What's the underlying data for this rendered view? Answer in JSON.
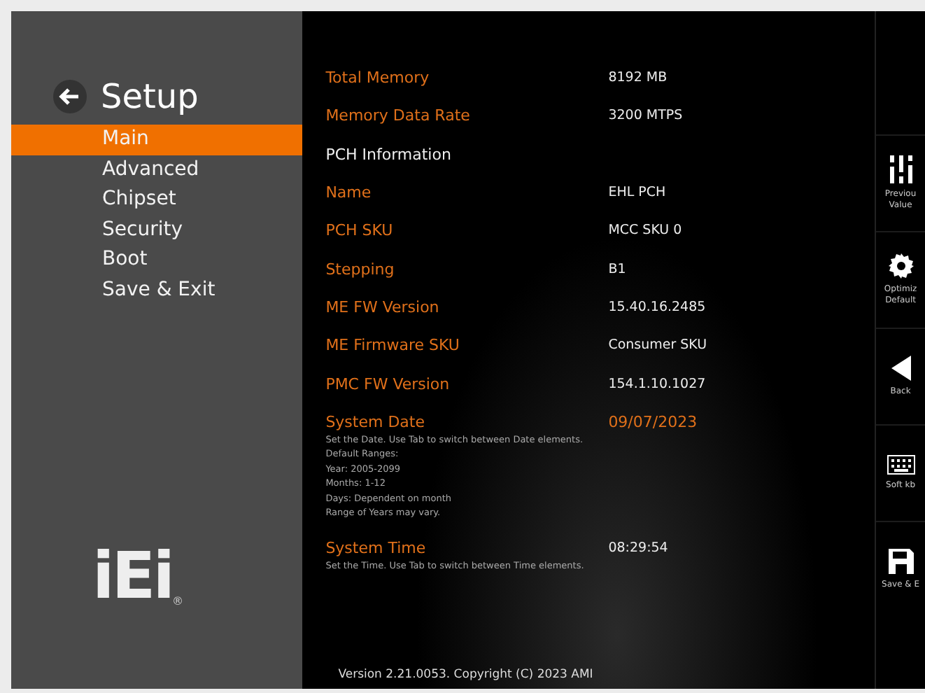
{
  "sidebar": {
    "title": "Setup",
    "items": [
      {
        "label": "Main",
        "selected": true
      },
      {
        "label": "Advanced",
        "selected": false
      },
      {
        "label": "Chipset",
        "selected": false
      },
      {
        "label": "Security",
        "selected": false
      },
      {
        "label": "Boot",
        "selected": false
      },
      {
        "label": "Save & Exit",
        "selected": false
      }
    ],
    "logo": "iEi",
    "logo_mark": "®"
  },
  "rows": [
    {
      "kind": "field",
      "label": "Total Memory",
      "value": "8192 MB",
      "selected": false
    },
    {
      "kind": "field",
      "label": "Memory Data Rate",
      "value": "3200 MTPS",
      "selected": false
    },
    {
      "kind": "heading",
      "label": "PCH Information"
    },
    {
      "kind": "field",
      "label": "Name",
      "value": "EHL PCH",
      "selected": false
    },
    {
      "kind": "field",
      "label": "PCH SKU",
      "value": "MCC SKU 0",
      "selected": false
    },
    {
      "kind": "field",
      "label": "Stepping",
      "value": "B1",
      "selected": false
    },
    {
      "kind": "field",
      "label": "ME FW Version",
      "value": "15.40.16.2485",
      "selected": false
    },
    {
      "kind": "field",
      "label": "ME Firmware SKU",
      "value": "Consumer SKU",
      "selected": false
    },
    {
      "kind": "field",
      "label": "PMC FW Version",
      "value": "154.1.10.1027",
      "selected": false
    },
    {
      "kind": "field",
      "label": "System Date",
      "value": "09/07/2023",
      "selected": true
    },
    {
      "kind": "help",
      "lines": [
        "Set the Date. Use Tab to switch between Date elements.",
        "Default Ranges:",
        "Year: 2005-2099",
        "Months: 1-12",
        "Days: Dependent on month",
        "Range of Years may vary."
      ]
    },
    {
      "kind": "field",
      "label": "System Time",
      "value": "08:29:54",
      "selected": false
    },
    {
      "kind": "help",
      "lines": [
        "Set the Time. Use Tab to switch between Time elements."
      ]
    }
  ],
  "footer": "Version 2.21.0053. Copyright (C) 2023 AMI",
  "actions": [
    {
      "kind": "sliders",
      "lines": [
        "Previou",
        "Value"
      ]
    },
    {
      "kind": "gear",
      "lines": [
        "Optimiz",
        "Default"
      ]
    },
    {
      "kind": "back",
      "lines": [
        "Back"
      ]
    },
    {
      "kind": "keyboard",
      "lines": [
        "Soft kb"
      ]
    },
    {
      "kind": "save",
      "lines": [
        "Save & E"
      ]
    }
  ]
}
